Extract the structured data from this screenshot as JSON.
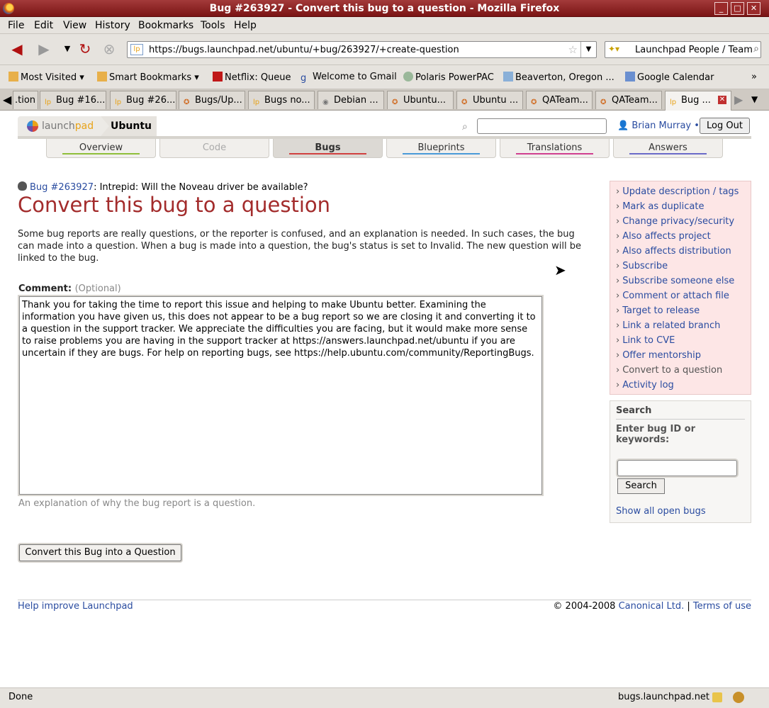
{
  "window": {
    "title": "Bug #263927 - Convert this bug to a question - Mozilla Firefox"
  },
  "menu": [
    "File",
    "Edit",
    "View",
    "History",
    "Bookmarks",
    "Tools",
    "Help"
  ],
  "nav": {
    "url": "https://bugs.launchpad.net/ubuntu/+bug/263927/+create-question",
    "search_text": "Launchpad People / Team"
  },
  "bookmarks": [
    "Most Visited ▾",
    "Smart Bookmarks ▾",
    "Netflix: Queue",
    "Welcome to Gmail",
    "Polaris PowerPAC",
    "Beaverton, Oregon ...",
    "Google Calendar",
    "»"
  ],
  "tabs": [
    ".tion",
    "Bug #16...",
    "Bug #26...",
    "Bugs/Up...",
    "Bugs no...",
    "Debian ...",
    "Ubuntu...",
    "Ubuntu ...",
    "QATeam...",
    "QATeam...",
    "Bug ..."
  ],
  "lp": {
    "logo_a": "launch",
    "logo_b": "pad",
    "crumb": "Ubuntu",
    "user": "Brian Murray •",
    "logout": "Log Out",
    "app_tabs": [
      "Overview",
      "Code",
      "Bugs",
      "Blueprints",
      "Translations",
      "Answers"
    ]
  },
  "main": {
    "bug_link": "Bug #263927",
    "bug_title": ": Intrepid: Will the Noveau driver be available?",
    "heading": "Convert this bug to a question",
    "intro": "Some bug reports are really questions, or the reporter is confused, and an explanation is needed. In such cases, the bug can made into a question. When a bug is made into a question, the bug's status is set to Invalid. The new question will be linked to the bug.",
    "comment_label": "Comment:",
    "comment_optional": "(Optional)",
    "comment_text": "Thank you for taking the time to report this issue and helping to make Ubuntu better. Examining the information you have given us, this does not appear to be a bug report so we are closing it and converting it to a question in the support tracker. We appreciate the difficulties you are facing, but it would make more sense to raise problems you are having in the support tracker at https://answers.launchpad.net/ubuntu if you are uncertain if they are bugs. For help on reporting bugs, see https://help.ubuntu.com/community/ReportingBugs.",
    "hint": "An explanation of why the bug report is a question.",
    "submit": "Convert this Bug into a Question"
  },
  "actions": [
    "Update description / tags",
    "Mark as duplicate",
    "Change privacy/security",
    "Also affects project",
    "Also affects distribution",
    "Subscribe",
    "Subscribe someone else",
    "Comment or attach file",
    "Target to release",
    "Link a related branch",
    "Link to CVE",
    "Offer mentorship",
    "Convert to a question",
    "Activity log"
  ],
  "side_search": {
    "title": "Search",
    "label": "Enter bug ID or keywords:",
    "button": "Search",
    "all": "Show all open bugs"
  },
  "footer": {
    "left": "Help improve Launchpad",
    "copy": "© 2004-2008",
    "canonical": "Canonical Ltd.",
    "sep": "|",
    "terms": "Terms of use"
  },
  "status": {
    "text": "Done",
    "host": "bugs.launchpad.net"
  },
  "colors": {
    "title_bar": "#8a2020",
    "heading": "#a32c2c",
    "link": "#2a4ca0",
    "actions_bg": "#fde6e6"
  }
}
